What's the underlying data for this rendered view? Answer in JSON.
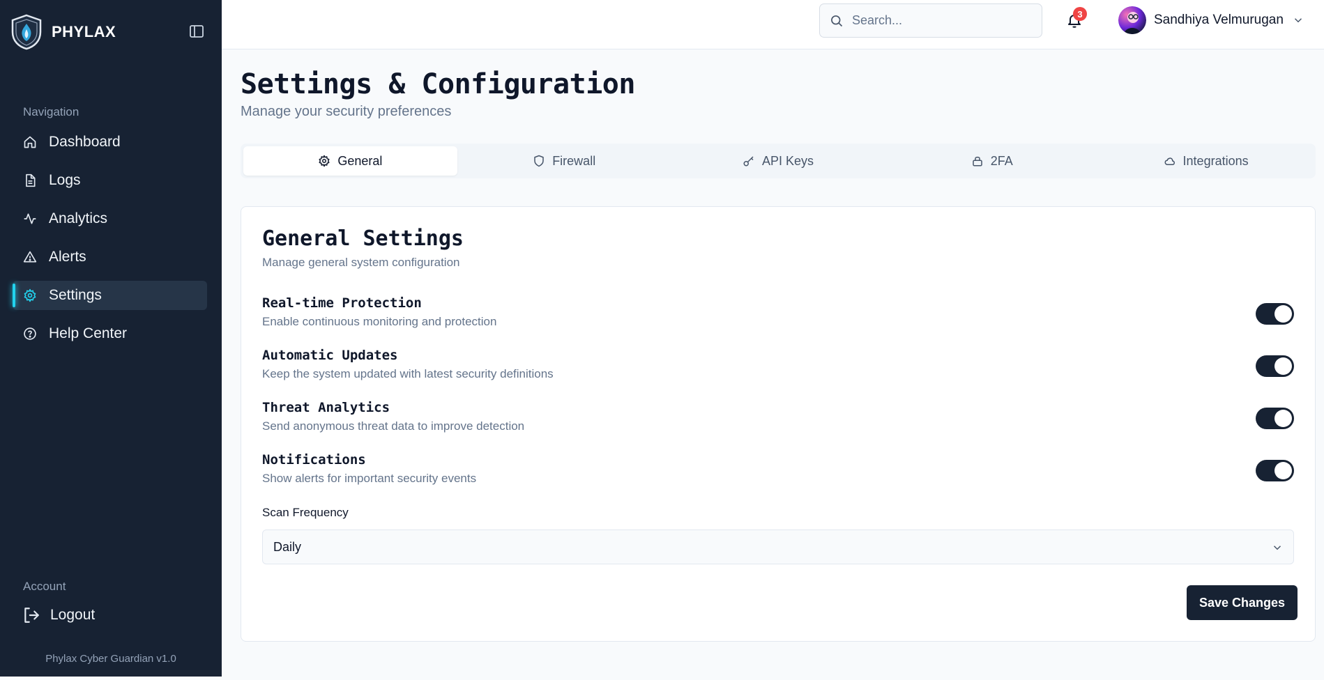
{
  "brand": {
    "name": "PHYLAX"
  },
  "sidebar": {
    "nav_heading": "Navigation",
    "items": [
      {
        "label": "Dashboard",
        "icon": "home-icon"
      },
      {
        "label": "Logs",
        "icon": "file-text-icon"
      },
      {
        "label": "Analytics",
        "icon": "activity-icon"
      },
      {
        "label": "Alerts",
        "icon": "alert-triangle-icon"
      },
      {
        "label": "Settings",
        "icon": "gear-icon",
        "active": true
      },
      {
        "label": "Help Center",
        "icon": "help-circle-icon"
      }
    ],
    "account_heading": "Account",
    "logout_label": "Logout",
    "version": "Phylax Cyber Guardian v1.0"
  },
  "header": {
    "search_placeholder": "Search...",
    "notification_count": "3",
    "user_name": "Sandhiya Velmurugan"
  },
  "page": {
    "title": "Settings & Configuration",
    "subtitle": "Manage your security preferences"
  },
  "tabs": [
    {
      "label": "General",
      "icon": "gear-icon",
      "active": true
    },
    {
      "label": "Firewall",
      "icon": "shield-icon"
    },
    {
      "label": "API Keys",
      "icon": "key-icon"
    },
    {
      "label": "2FA",
      "icon": "lock-icon"
    },
    {
      "label": "Integrations",
      "icon": "cloud-icon"
    }
  ],
  "general": {
    "title": "General Settings",
    "subtitle": "Manage general system configuration",
    "settings": [
      {
        "label": "Real-time Protection",
        "description": "Enable continuous monitoring and protection",
        "enabled": true
      },
      {
        "label": "Automatic Updates",
        "description": "Keep the system updated with latest security definitions",
        "enabled": true
      },
      {
        "label": "Threat Analytics",
        "description": "Send anonymous threat data to improve detection",
        "enabled": true
      },
      {
        "label": "Notifications",
        "description": "Show alerts for important security events",
        "enabled": true
      }
    ],
    "scan_frequency_label": "Scan Frequency",
    "scan_frequency_value": "Daily",
    "save_label": "Save Changes"
  },
  "colors": {
    "sidebar_bg": "#172233",
    "accent": "#22d3ee",
    "badge": "#ef4444",
    "toggle_on": "#172233"
  }
}
